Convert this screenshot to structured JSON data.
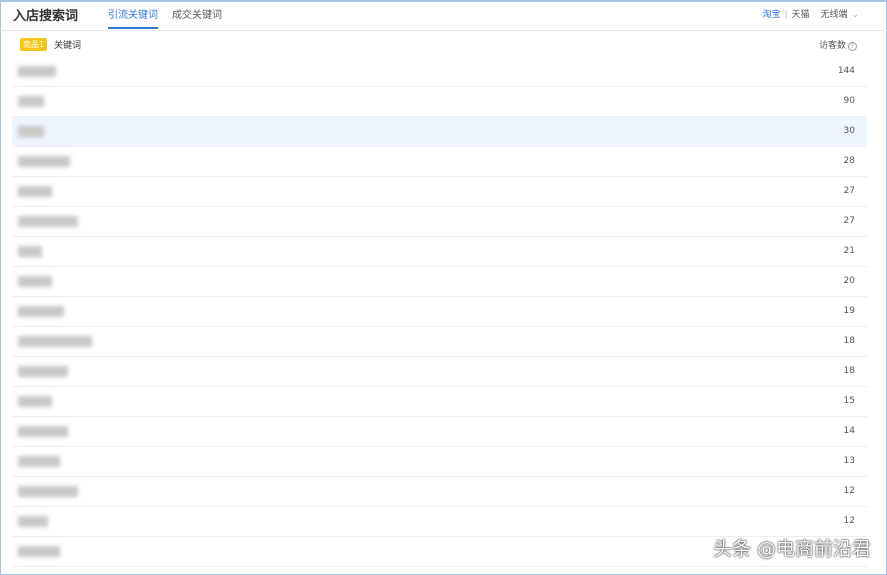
{
  "header": {
    "title": "入店搜索词",
    "tabs": [
      "引流关键词",
      "成交关键词"
    ],
    "platforms": [
      "淘宝",
      "天猫"
    ],
    "device": "无线端"
  },
  "table": {
    "badge": "竞品1",
    "col_keyword": "关键词",
    "col_visitors": "访客数",
    "rows": [
      {
        "v": "144"
      },
      {
        "v": "90"
      },
      {
        "v": "30"
      },
      {
        "v": "28"
      },
      {
        "v": "27"
      },
      {
        "v": "27"
      },
      {
        "v": "21"
      },
      {
        "v": "20"
      },
      {
        "v": "19"
      },
      {
        "v": "18"
      },
      {
        "v": "18"
      },
      {
        "v": "15"
      },
      {
        "v": "14"
      },
      {
        "v": "13"
      },
      {
        "v": "12"
      },
      {
        "v": "12"
      },
      {
        "v": ""
      }
    ]
  },
  "watermark": "头条 @电商前沿君"
}
